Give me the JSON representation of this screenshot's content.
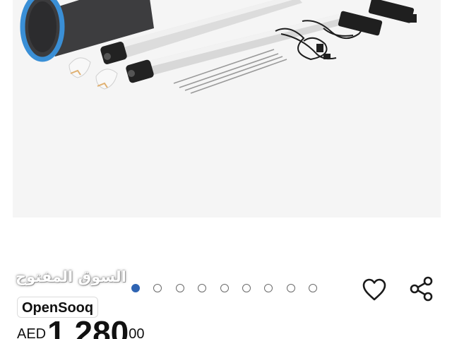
{
  "watermark": {
    "arabic_text": "السوق المفتوح",
    "brand": "OpenSooq"
  },
  "carousel": {
    "dots": [
      {
        "active": true
      },
      {
        "active": false
      },
      {
        "active": false
      },
      {
        "active": false
      },
      {
        "active": false
      },
      {
        "active": false
      },
      {
        "active": false
      },
      {
        "active": false
      },
      {
        "active": false
      }
    ]
  },
  "price": {
    "currency": "AED",
    "whole": "1,280",
    "fraction": "00"
  },
  "icons": {
    "favorite": "heart-icon",
    "share": "share-icon"
  },
  "colors": {
    "active_dot": "#2f64b3",
    "inactive_dot": "#6b6b6b",
    "image_background": "#f5f5f5"
  }
}
